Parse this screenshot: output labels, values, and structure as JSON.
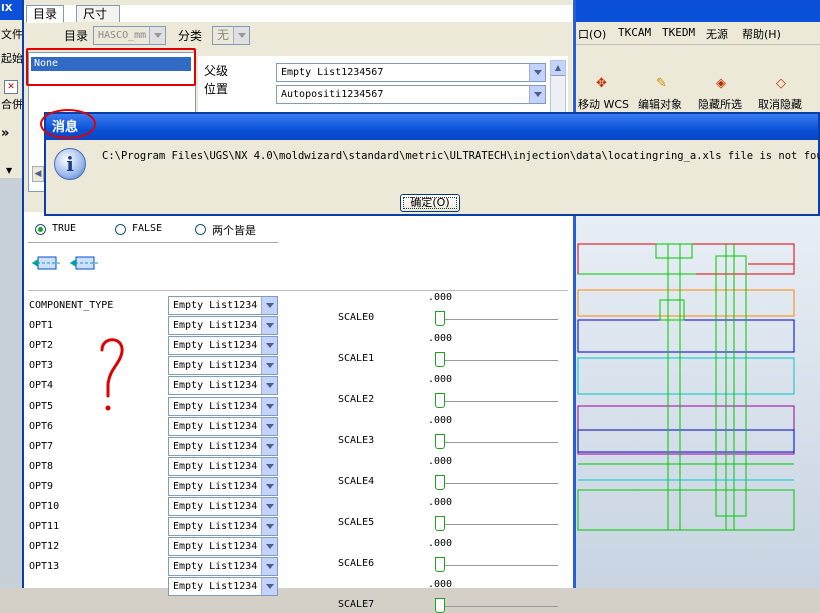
{
  "app": {
    "title_fragment": "IX"
  },
  "left_strip": {
    "file": "文件",
    "start": "起始",
    "combine": "合併",
    "chevron": "»"
  },
  "tabs": [
    {
      "label": "目录"
    },
    {
      "label": "尺寸"
    }
  ],
  "catalog": {
    "label": "目录",
    "value": "HASCO_mm",
    "category_label": "分类",
    "category_value": "无"
  },
  "list": {
    "selected": "None"
  },
  "fields": {
    "parent_label": "父级",
    "parent_value": "Empty List1234567",
    "position_label": "位置",
    "position_value": "Autopositi1234567"
  },
  "message": {
    "title": "消息",
    "text": "C:\\Program Files\\UGS\\NX 4.0\\moldwizard\\standard\\metric\\ULTRATECH\\injection\\data\\locatingring_a.xls file is not found.",
    "ok": "确定(O)"
  },
  "menubar": [
    {
      "label": "口(O)"
    },
    {
      "label": "TKCAM"
    },
    {
      "label": "TKEDM"
    },
    {
      "label": "无源"
    },
    {
      "label": "帮助(H)"
    }
  ],
  "toolbar": [
    {
      "label": "移动 WCS"
    },
    {
      "label": "编辑对象"
    },
    {
      "label": "隐藏所选"
    },
    {
      "label": "取消隐藏"
    }
  ],
  "radios": {
    "true": "TRUE",
    "false": "FALSE",
    "both": "两个皆是",
    "selected": "true"
  },
  "component_rows": [
    {
      "label": "COMPONENT_TYPE",
      "value": "Empty List1234"
    },
    {
      "label": "OPT1",
      "value": "Empty List1234"
    },
    {
      "label": "OPT2",
      "value": "Empty List1234"
    },
    {
      "label": "OPT3",
      "value": "Empty List1234"
    },
    {
      "label": "OPT4",
      "value": "Empty List1234"
    },
    {
      "label": "OPT5",
      "value": "Empty List1234"
    },
    {
      "label": "OPT6",
      "value": "Empty List1234"
    },
    {
      "label": "OPT7",
      "value": "Empty List1234"
    },
    {
      "label": "OPT8",
      "value": "Empty List1234"
    },
    {
      "label": "OPT9",
      "value": "Empty List1234"
    },
    {
      "label": "OPT10",
      "value": "Empty List1234"
    },
    {
      "label": "OPT11",
      "value": "Empty List1234"
    },
    {
      "label": "OPT12",
      "value": "Empty List1234"
    },
    {
      "label": "OPT13",
      "value": "Empty List1234"
    },
    {
      "label": "",
      "value": "Empty List1234"
    }
  ],
  "scales": [
    {
      "label": "SCALE0",
      "value": ".000"
    },
    {
      "label": "SCALE1",
      "value": ".000"
    },
    {
      "label": "SCALE2",
      "value": ".000"
    },
    {
      "label": "SCALE3",
      "value": ".000"
    },
    {
      "label": "SCALE4",
      "value": ".000"
    },
    {
      "label": "SCALE5",
      "value": ".000"
    },
    {
      "label": "SCALE6",
      "value": ".000"
    },
    {
      "label": "SCALE7",
      "value": ".000"
    }
  ],
  "annotation": {
    "mark": "?",
    "color": "#e00000"
  }
}
